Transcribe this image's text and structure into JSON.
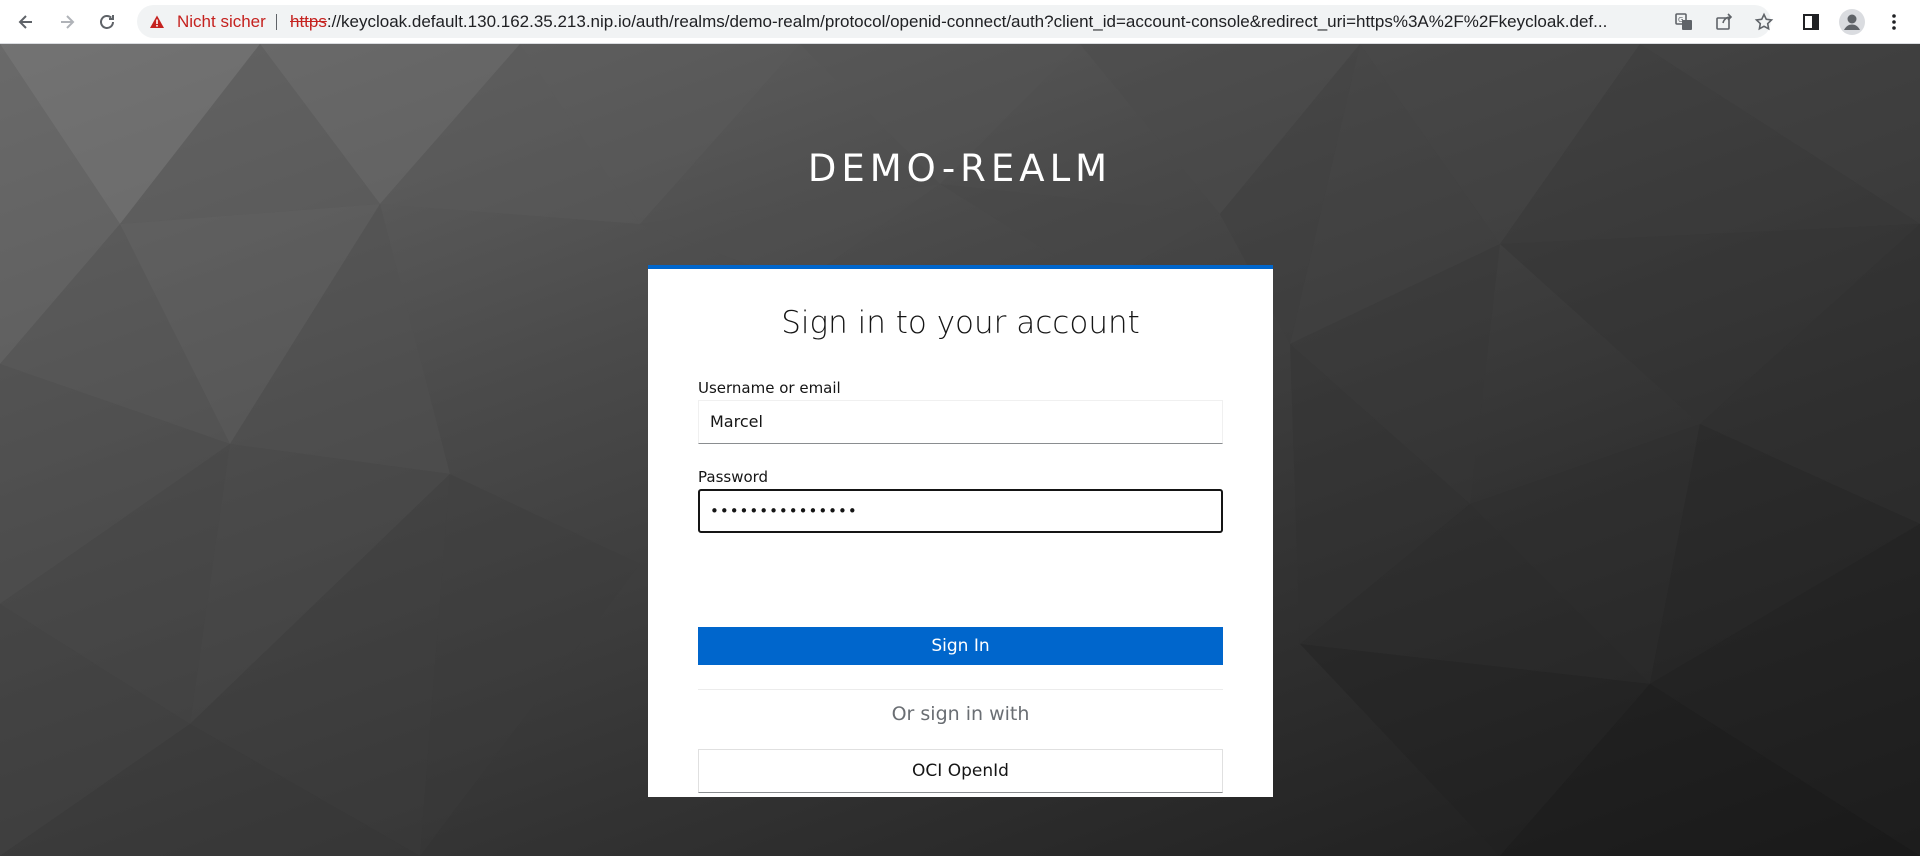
{
  "browser": {
    "security_status": "Nicht sicher",
    "url_scheme": "https",
    "url_rest": "://keycloak.default.130.162.35.213.nip.io/auth/realms/demo-realm/protocol/openid-connect/auth?client_id=account-console&redirect_uri=https%3A%2F%2Fkeycloak.def...",
    "icons": {
      "back": "arrow-left-icon",
      "forward": "arrow-right-icon",
      "reload": "reload-icon",
      "warning": "warning-triangle-icon",
      "translate": "translate-icon",
      "share": "share-icon",
      "bookmark": "star-icon",
      "side_panel": "side-panel-icon",
      "profile": "profile-icon",
      "menu": "kebab-menu-icon"
    }
  },
  "realm": {
    "title": "DEMO-REALM"
  },
  "login": {
    "heading": "Sign in to your account",
    "username_label": "Username or email",
    "username_value": "Marcel",
    "password_label": "Password",
    "password_value": "•••••••••••••••",
    "sign_in_label": "Sign In",
    "or_text": "Or sign in with",
    "provider_label": "OCI OpenId"
  },
  "colors": {
    "primary": "#0066cc",
    "insecure": "#c5221f"
  }
}
